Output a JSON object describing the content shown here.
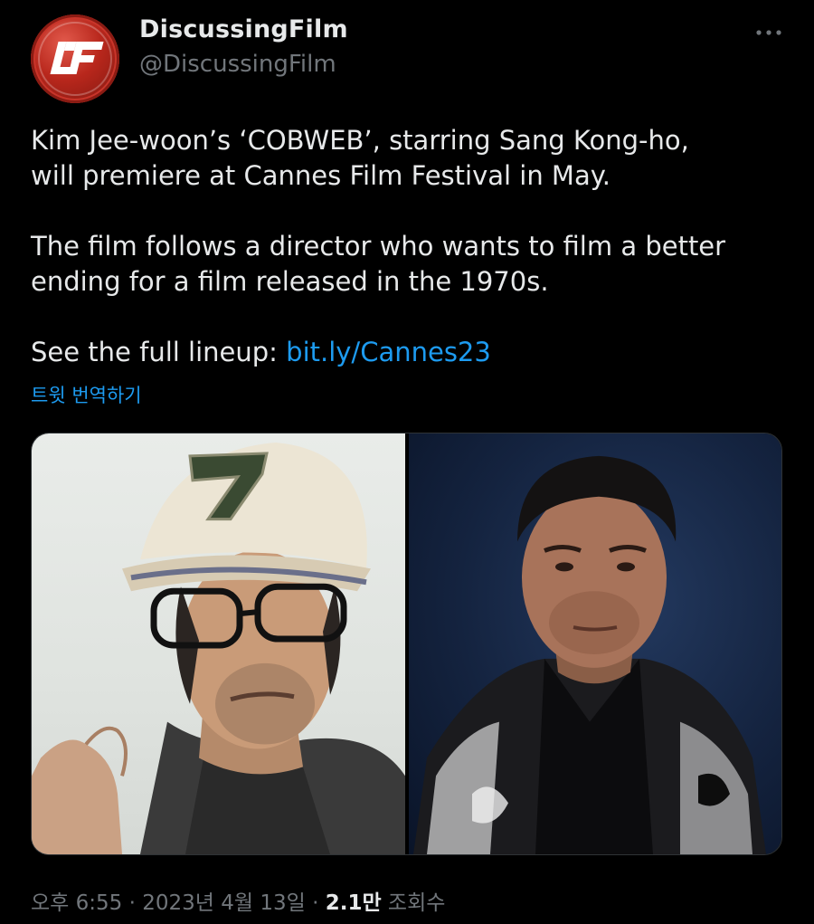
{
  "author": {
    "display_name": "DiscussingFilm",
    "handle": "@DiscussingFilm",
    "avatar_logo": "DF"
  },
  "more_icon": "more-horizontal-icon",
  "tweet": {
    "line1": "Kim Jee-woon’s ‘COBWEB’, starring Sang Kong-ho,\nwill premiere at Cannes Film Festival in May.",
    "line2": "The film follows a director who wants to film a better\nending for a film released in the 1970s.",
    "lineup_prefix": "See the full lineup: ",
    "lineup_link": "bit.ly/Cannes23"
  },
  "translate_label": "트윗 번역하기",
  "media": {
    "images": [
      "man in cap and glasses",
      "man in patterned jacket"
    ]
  },
  "meta": {
    "time": "오후 6:55",
    "separator": " · ",
    "date": "2023년 4월 13일",
    "views_count": "2.1만",
    "views_label": " 조회수"
  },
  "colors": {
    "background": "#000000",
    "text": "#e7e9ea",
    "secondary": "#71767b",
    "link": "#1d9bf0",
    "avatar": "#b8271c"
  }
}
